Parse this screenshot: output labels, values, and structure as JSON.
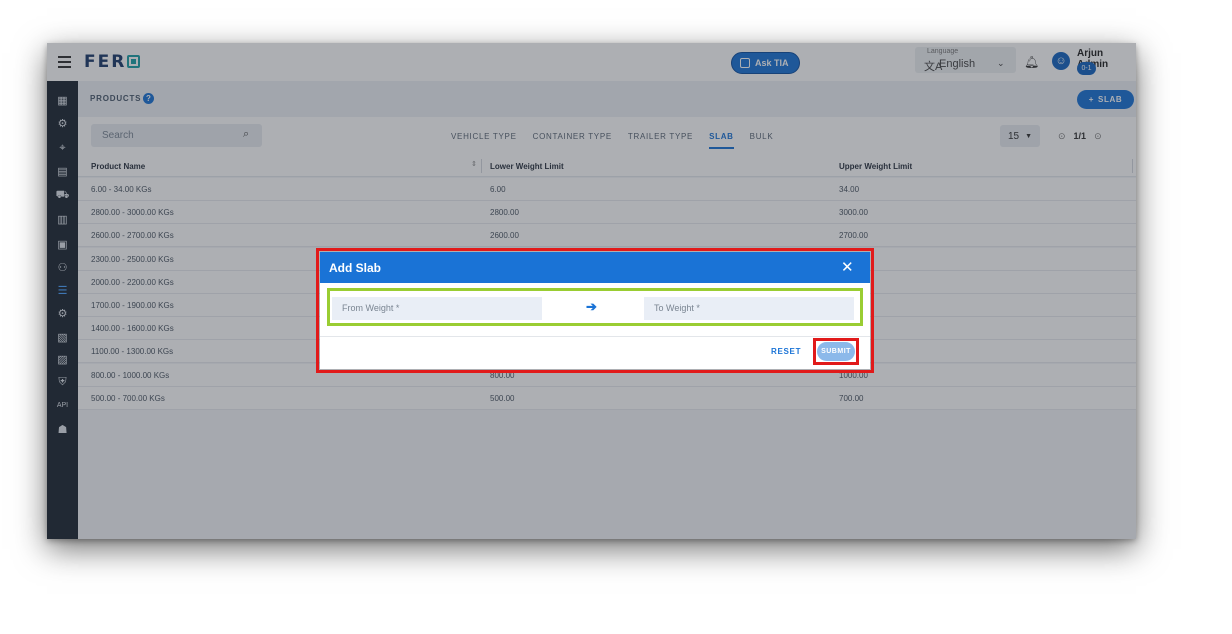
{
  "topbar": {
    "logo_text": "FER",
    "ask_tia_label": "Ask TIA",
    "language_label": "Language",
    "language_glyph": "文A",
    "language_value": "English",
    "user_name": "Arjun Admin",
    "user_badge": "0-1"
  },
  "sidebar": {
    "items": [
      {
        "icon": "dashboard-icon",
        "glyph": "▦"
      },
      {
        "icon": "settings-network-icon",
        "glyph": "⚙"
      },
      {
        "icon": "location-icon",
        "glyph": "⌖"
      },
      {
        "icon": "truck-list-icon",
        "glyph": "▤"
      },
      {
        "icon": "truck-icon",
        "glyph": "⛟"
      },
      {
        "icon": "container-icon",
        "glyph": "▥"
      },
      {
        "icon": "building-icon",
        "glyph": "▣"
      },
      {
        "icon": "users-icon",
        "glyph": "⚇"
      },
      {
        "icon": "products-icon",
        "glyph": "☰"
      },
      {
        "icon": "gear-icon",
        "glyph": "⚙"
      },
      {
        "icon": "document-icon",
        "glyph": "▧"
      },
      {
        "icon": "calendar-icon",
        "glyph": "▨"
      },
      {
        "icon": "shield-icon",
        "glyph": "⛨"
      },
      {
        "icon": "api-icon",
        "glyph": "API"
      },
      {
        "icon": "robot-icon",
        "glyph": "☗"
      }
    ]
  },
  "page": {
    "title": "PRODUCTS",
    "help_glyph": "?",
    "add_button_label": "SLAB",
    "add_button_glyph": "+"
  },
  "filters": {
    "search_placeholder": "Search",
    "tabs": [
      "VEHICLE TYPE",
      "CONTAINER TYPE",
      "TRAILER TYPE",
      "SLAB",
      "BULK"
    ],
    "active_tab": "SLAB",
    "page_size": "15",
    "pager_count": "1/1"
  },
  "table": {
    "columns": [
      "Product Name",
      "Lower Weight Limit",
      "Upper Weight Limit"
    ],
    "rows": [
      [
        "6.00 - 34.00 KGs",
        "6.00",
        "34.00"
      ],
      [
        "2800.00 - 3000.00 KGs",
        "2800.00",
        "3000.00"
      ],
      [
        "2600.00 - 2700.00 KGs",
        "2600.00",
        "2700.00"
      ],
      [
        "2300.00 - 2500.00 KGs",
        "",
        ""
      ],
      [
        "2000.00 - 2200.00 KGs",
        "",
        ""
      ],
      [
        "1700.00 - 1900.00 KGs",
        "",
        ""
      ],
      [
        "1400.00 - 1600.00 KGs",
        "",
        ""
      ],
      [
        "1100.00 - 1300.00 KGs",
        "",
        ""
      ],
      [
        "800.00 - 1000.00 KGs",
        "800.00",
        "1000.00"
      ],
      [
        "500.00 - 700.00 KGs",
        "500.00",
        "700.00"
      ]
    ]
  },
  "modal": {
    "title": "Add Slab",
    "close_glyph": "✕",
    "from_placeholder": "From Weight *",
    "to_placeholder": "To Weight *",
    "arrow_glyph": "➔",
    "reset_label": "RESET",
    "submit_label": "SUBMIT"
  }
}
